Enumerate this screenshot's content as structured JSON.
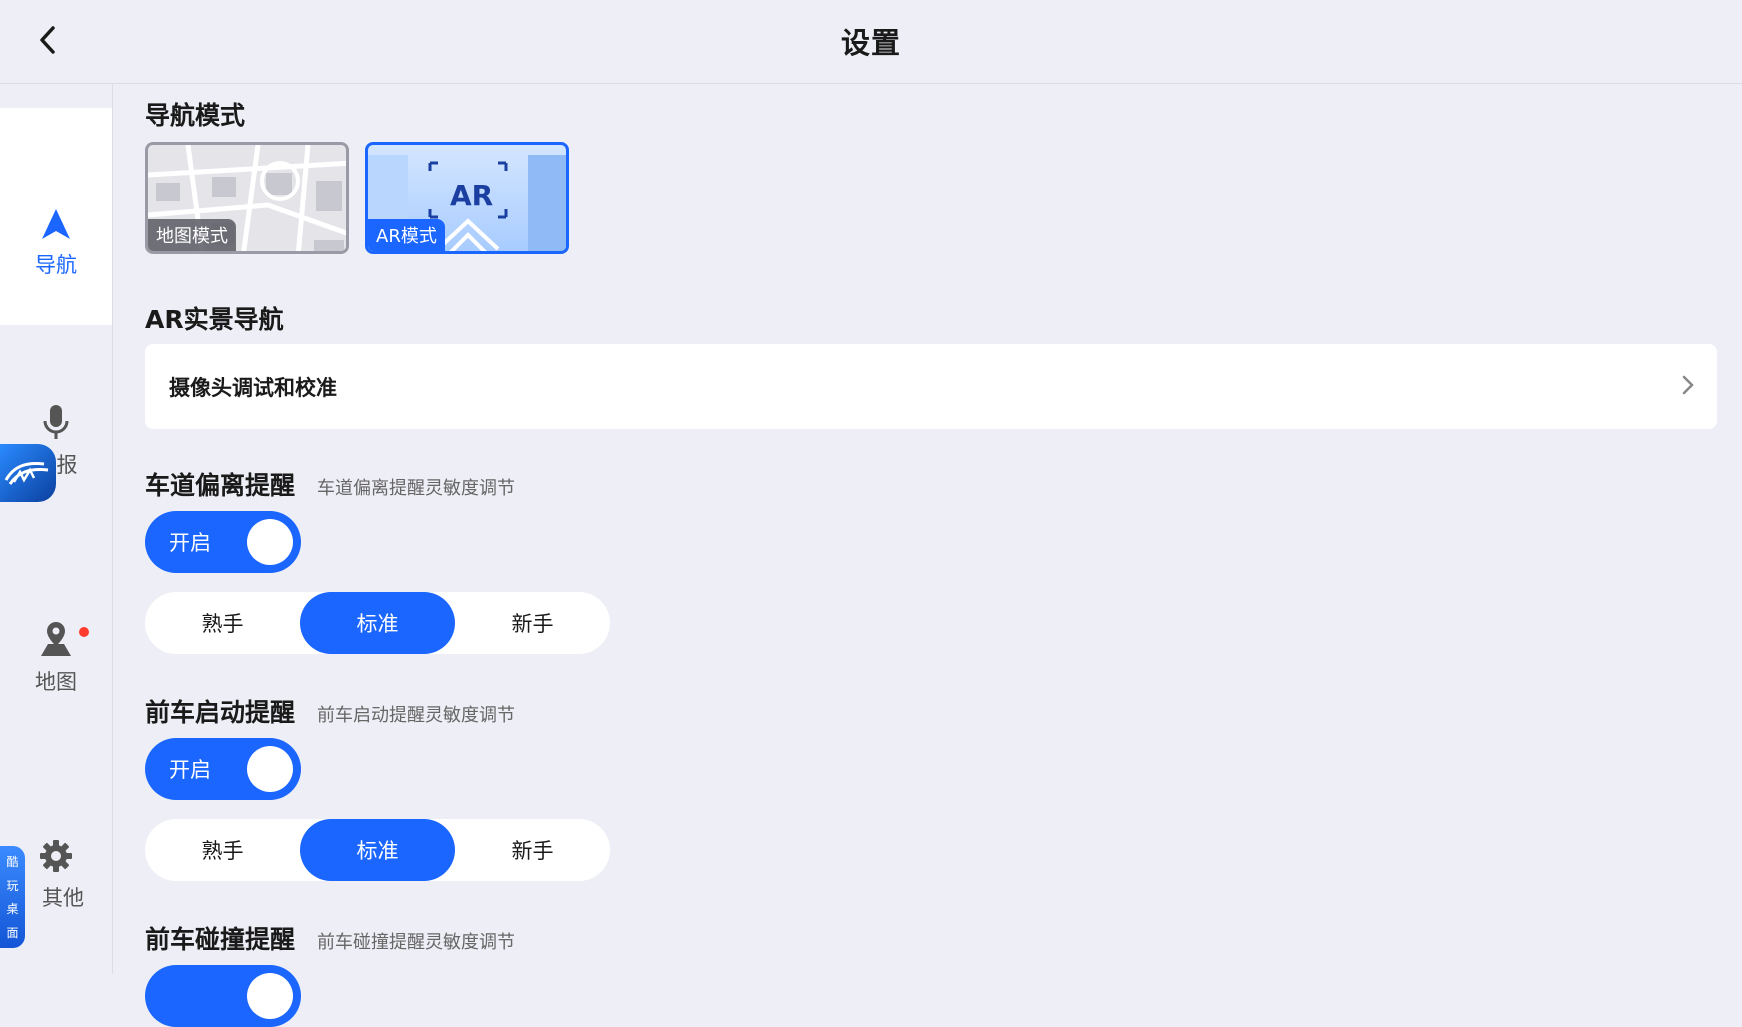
{
  "header": {
    "title": "设置",
    "back_icon": "chevron-left-icon"
  },
  "sidebar": {
    "items": [
      {
        "label": "导航",
        "icon": "navigation-arrow-icon",
        "active": true
      },
      {
        "label": "报",
        "icon": "microphone-icon",
        "active": false
      },
      {
        "label": "地图",
        "icon": "map-pin-icon",
        "active": false,
        "badge": true
      },
      {
        "label": "其他",
        "icon": "gear-icon",
        "active": false
      }
    ],
    "side_tab": [
      "酷",
      "玩",
      "桌",
      "面"
    ]
  },
  "nav_mode": {
    "title": "导航模式",
    "options": [
      {
        "label": "地图模式",
        "selected": false
      },
      {
        "label": "AR模式",
        "selected": true,
        "badge_text": "AR"
      }
    ]
  },
  "ar_nav": {
    "title": "AR实景导航",
    "row_label": "摄像头调试和校准"
  },
  "lane_departure": {
    "title": "车道偏离提醒",
    "subtitle": "车道偏离提醒灵敏度调节",
    "toggle_label": "开启",
    "options": [
      "熟手",
      "标准",
      "新手"
    ],
    "selected": "标准"
  },
  "front_start": {
    "title": "前车启动提醒",
    "subtitle": "前车启动提醒灵敏度调节",
    "toggle_label": "开启",
    "options": [
      "熟手",
      "标准",
      "新手"
    ],
    "selected": "标准"
  },
  "front_collision": {
    "title": "前车碰撞提醒",
    "subtitle": "前车碰撞提醒灵敏度调节"
  },
  "colors": {
    "accent": "#1a66ff",
    "background": "#eeeff6",
    "badge": "#ff3b30"
  }
}
